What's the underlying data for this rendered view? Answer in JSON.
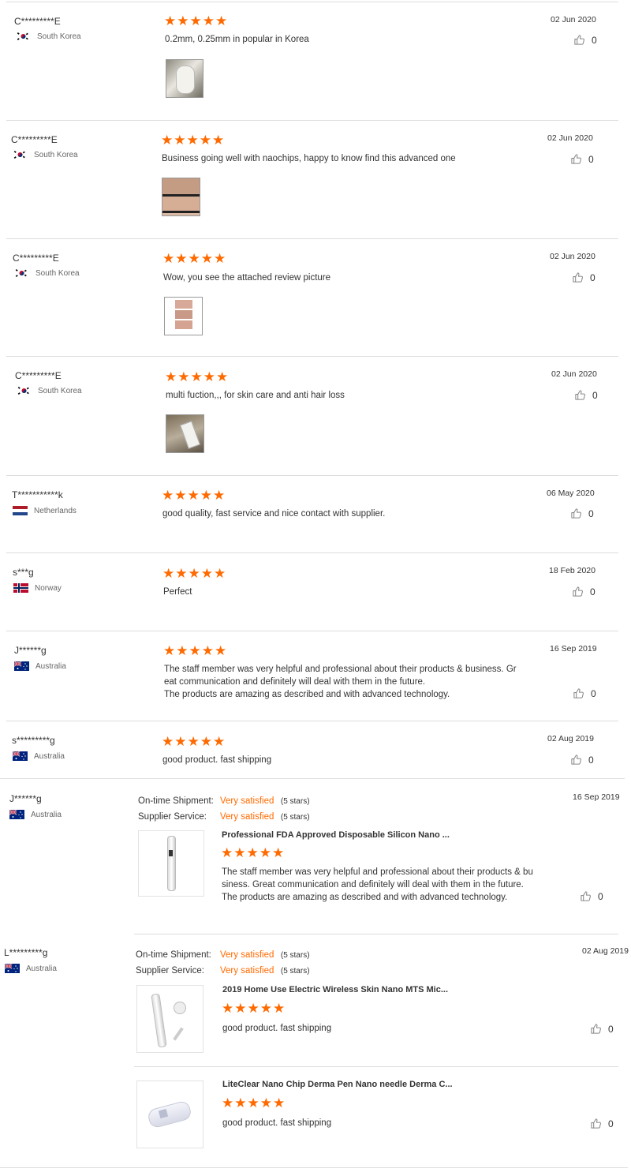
{
  "reviews": [
    {
      "name": "C*********E",
      "country": "South Korea",
      "rating": 5,
      "stars": "★★★★★",
      "text": "0.2mm, 0.25mm in popular in Korea",
      "date": "02 Jun 2020",
      "likes": "0"
    },
    {
      "name": "C*********E",
      "country": "South Korea",
      "rating": 5,
      "stars": "★★★★★",
      "text": "Business going well with naochips, happy to know find this advanced one",
      "date": "02 Jun 2020",
      "likes": "0"
    },
    {
      "name": "C*********E",
      "country": "South Korea",
      "rating": 5,
      "stars": "★★★★★",
      "text": "Wow, you see the attached review picture",
      "date": "02 Jun 2020",
      "likes": "0"
    },
    {
      "name": "C*********E",
      "country": "South Korea",
      "rating": 5,
      "stars": "★★★★★",
      "text": "multi fuction,,, for skin care and anti hair loss",
      "date": "02 Jun 2020",
      "likes": "0"
    },
    {
      "name": "T***********k",
      "country": "Netherlands",
      "rating": 5,
      "stars": "★★★★★",
      "text": "good quality, fast service and nice contact with supplier.",
      "date": "06 May 2020",
      "likes": "0"
    },
    {
      "name": "s***g",
      "country": "Norway",
      "rating": 5,
      "stars": "★★★★★",
      "text": "Perfect",
      "date": "18 Feb 2020",
      "likes": "0"
    },
    {
      "name": "J******g",
      "country": "Australia",
      "rating": 5,
      "stars": "★★★★★",
      "text_lines": [
        "The staff member was very helpful and professional about their products & business. Gr",
        "eat communication and definitely will deal with them in the future.",
        "The products are amazing as described and with advanced technology."
      ],
      "date": "16 Sep 2019",
      "likes": "0"
    },
    {
      "name": "s*********g",
      "country": "Australia",
      "rating": 5,
      "stars": "★★★★★",
      "text": "good product. fast shipping",
      "date": "02 Aug 2019",
      "likes": "0"
    }
  ],
  "supplier_reviews": [
    {
      "name": "J******g",
      "country": "Australia",
      "date": "16 Sep 2019",
      "shipment_label": "On-time Shipment:",
      "shipment_value": "Very satisfied",
      "shipment_count": "(5 stars)",
      "service_label": "Supplier Service:",
      "service_value": "Very satisfied",
      "service_count": "(5 stars)",
      "products": [
        {
          "title": "Professional FDA Approved Disposable Silicon Nano ...",
          "rating": 5,
          "stars": "★★★★★",
          "text_lines": [
            "The staff member was very helpful and professional about their products & bu",
            "siness. Great communication and definitely will deal with them in the future.",
            "The products are amazing as described and with advanced technology."
          ],
          "likes": "0"
        }
      ]
    },
    {
      "name": "L*********g",
      "country": "Australia",
      "date": "02 Aug 2019",
      "shipment_label": "On-time Shipment:",
      "shipment_value": "Very satisfied",
      "shipment_count": "(5 stars)",
      "service_label": "Supplier Service:",
      "service_value": "Very satisfied",
      "service_count": "(5 stars)",
      "products": [
        {
          "title": "2019 Home Use Electric Wireless Skin Nano MTS Mic...",
          "rating": 5,
          "stars": "★★★★★",
          "text": "good product. fast shipping",
          "likes": "0"
        },
        {
          "title": "LiteClear Nano Chip Derma Pen Nano needle Derma C...",
          "rating": 5,
          "stars": "★★★★★",
          "text": "good product. fast shipping",
          "likes": "0"
        }
      ]
    }
  ],
  "icons": {
    "like": "thumbs-up-icon",
    "flag_korea": "south-korea-flag-icon",
    "flag_nl": "netherlands-flag-icon",
    "flag_no": "norway-flag-icon",
    "flag_au": "australia-flag-icon"
  },
  "colors": {
    "accent": "#ff6a00",
    "divider": "#dddddd"
  }
}
